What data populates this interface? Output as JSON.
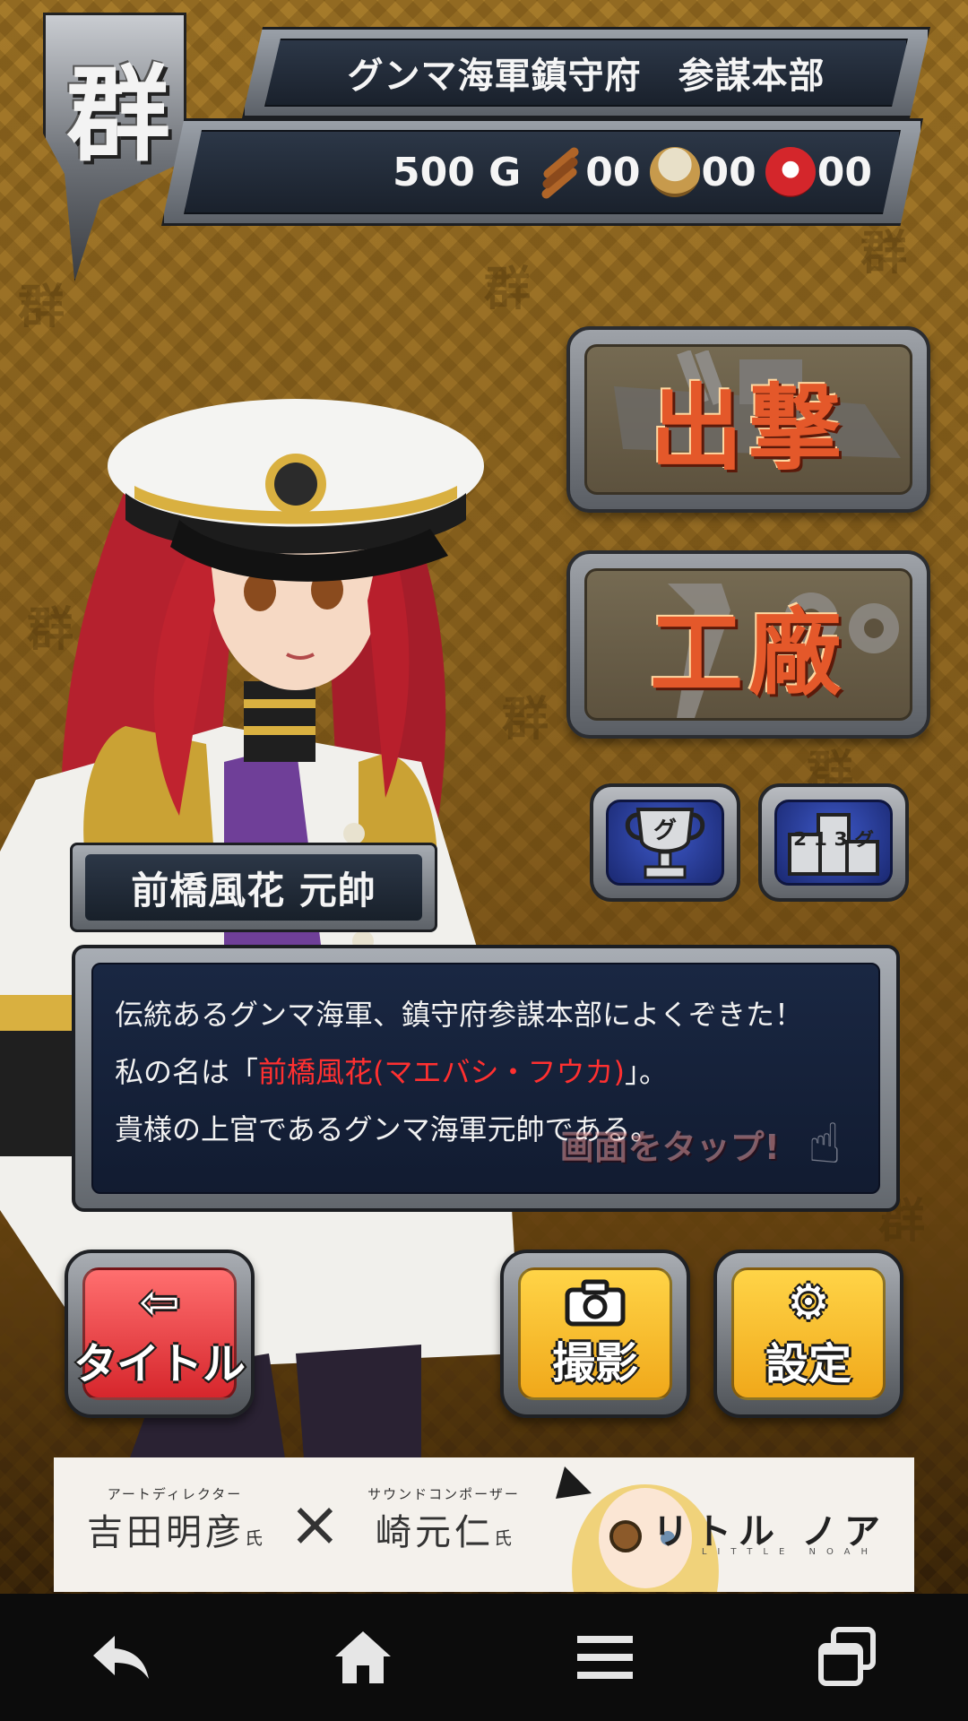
{
  "header": {
    "emblem_char": "群",
    "title": "グンマ海軍鎮守府　参謀本部"
  },
  "resources": {
    "gold": "500 G",
    "items": [
      {
        "icon": "skewer-icon",
        "count": "00"
      },
      {
        "icon": "bowl-icon",
        "count": "00"
      },
      {
        "icon": "daruma-icon",
        "count": "00"
      }
    ]
  },
  "menu": {
    "sortie_label": "出撃",
    "factory_label": "工廠"
  },
  "small_buttons": {
    "trophy_text": "グ",
    "ranking_text": "2 1 3 グ"
  },
  "character": {
    "name_title": "前橋風花 元帥"
  },
  "dialog": {
    "line1": "伝統あるグンマ海軍、鎮守府参謀本部によくぞきた！",
    "line2_prefix": "私の名は「",
    "line2_name": "前橋風花(マエバシ・フウカ)",
    "line2_suffix": "」。",
    "line3": "貴様の上官であるグンマ海軍元帥である。",
    "tap_hint": "画面をタップ!"
  },
  "bottom_buttons": {
    "title_label": "タイトル",
    "photo_label": "撮影",
    "settings_label": "設定"
  },
  "ad": {
    "role1": "アートディレクター",
    "person1": "吉田明彦",
    "honorific1": "氏",
    "role2": "サウンドコンポーザー",
    "person2": "崎元仁",
    "honorific2": "氏",
    "logo": "リトル ノア",
    "logo_sub": "LITTLE NOAH"
  },
  "colors": {
    "dialog_highlight": "#ff3030",
    "menu_label": "#e4582a",
    "title_button": "#d6262c",
    "action_button": "#f0a81a"
  }
}
